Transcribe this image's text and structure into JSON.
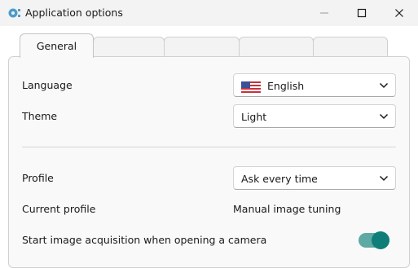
{
  "window": {
    "title": "Application options",
    "icons": {
      "app": "gear-icon",
      "minimize": "minimize-icon",
      "maximize": "maximize-icon",
      "close": "close-icon"
    }
  },
  "tabs": [
    {
      "label": "General",
      "active": true
    },
    {
      "label": "",
      "active": false
    },
    {
      "label": "",
      "active": false
    },
    {
      "label": "",
      "active": false
    },
    {
      "label": "",
      "active": false
    }
  ],
  "general": {
    "language": {
      "label": "Language",
      "value": "English",
      "flag": "us-flag-icon"
    },
    "theme": {
      "label": "Theme",
      "value": "Light"
    },
    "profile": {
      "label": "Profile",
      "value": "Ask every time"
    },
    "current_profile": {
      "label": "Current profile",
      "value": "Manual image tuning"
    },
    "start_acquisition": {
      "label": "Start image acquisition when opening a camera",
      "enabled": true
    }
  },
  "colors": {
    "accent": "#0f7e78",
    "accent_track": "#5da9a3",
    "panel_bg": "#f9f9f9",
    "titlebar_bg": "#f3f3f3"
  }
}
